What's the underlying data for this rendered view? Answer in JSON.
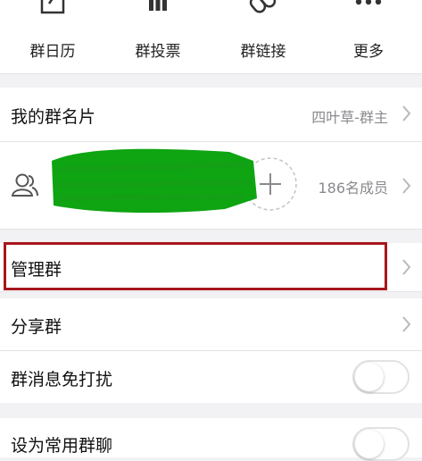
{
  "shortcuts": [
    {
      "label": "群日历",
      "icon": "calendar-icon"
    },
    {
      "label": "群投票",
      "icon": "vote-icon"
    },
    {
      "label": "群链接",
      "icon": "link-icon"
    },
    {
      "label": "更多",
      "icon": "more-icon"
    }
  ],
  "group_card": {
    "label": "我的群名片",
    "value": "四叶草-群主"
  },
  "members": {
    "count_label": "186名成员",
    "add_icon": "plus-icon",
    "member_icon": "members-icon"
  },
  "menu": {
    "manage": "管理群",
    "share": "分享群",
    "mute": "群消息免打扰",
    "pin": "设为常用群聊"
  },
  "toggles": {
    "mute_on": false,
    "pin_on": false
  },
  "colors": {
    "highlight": "#a8161e",
    "scribble": "#0ea412",
    "secondary_text": "#8a8a8e"
  }
}
